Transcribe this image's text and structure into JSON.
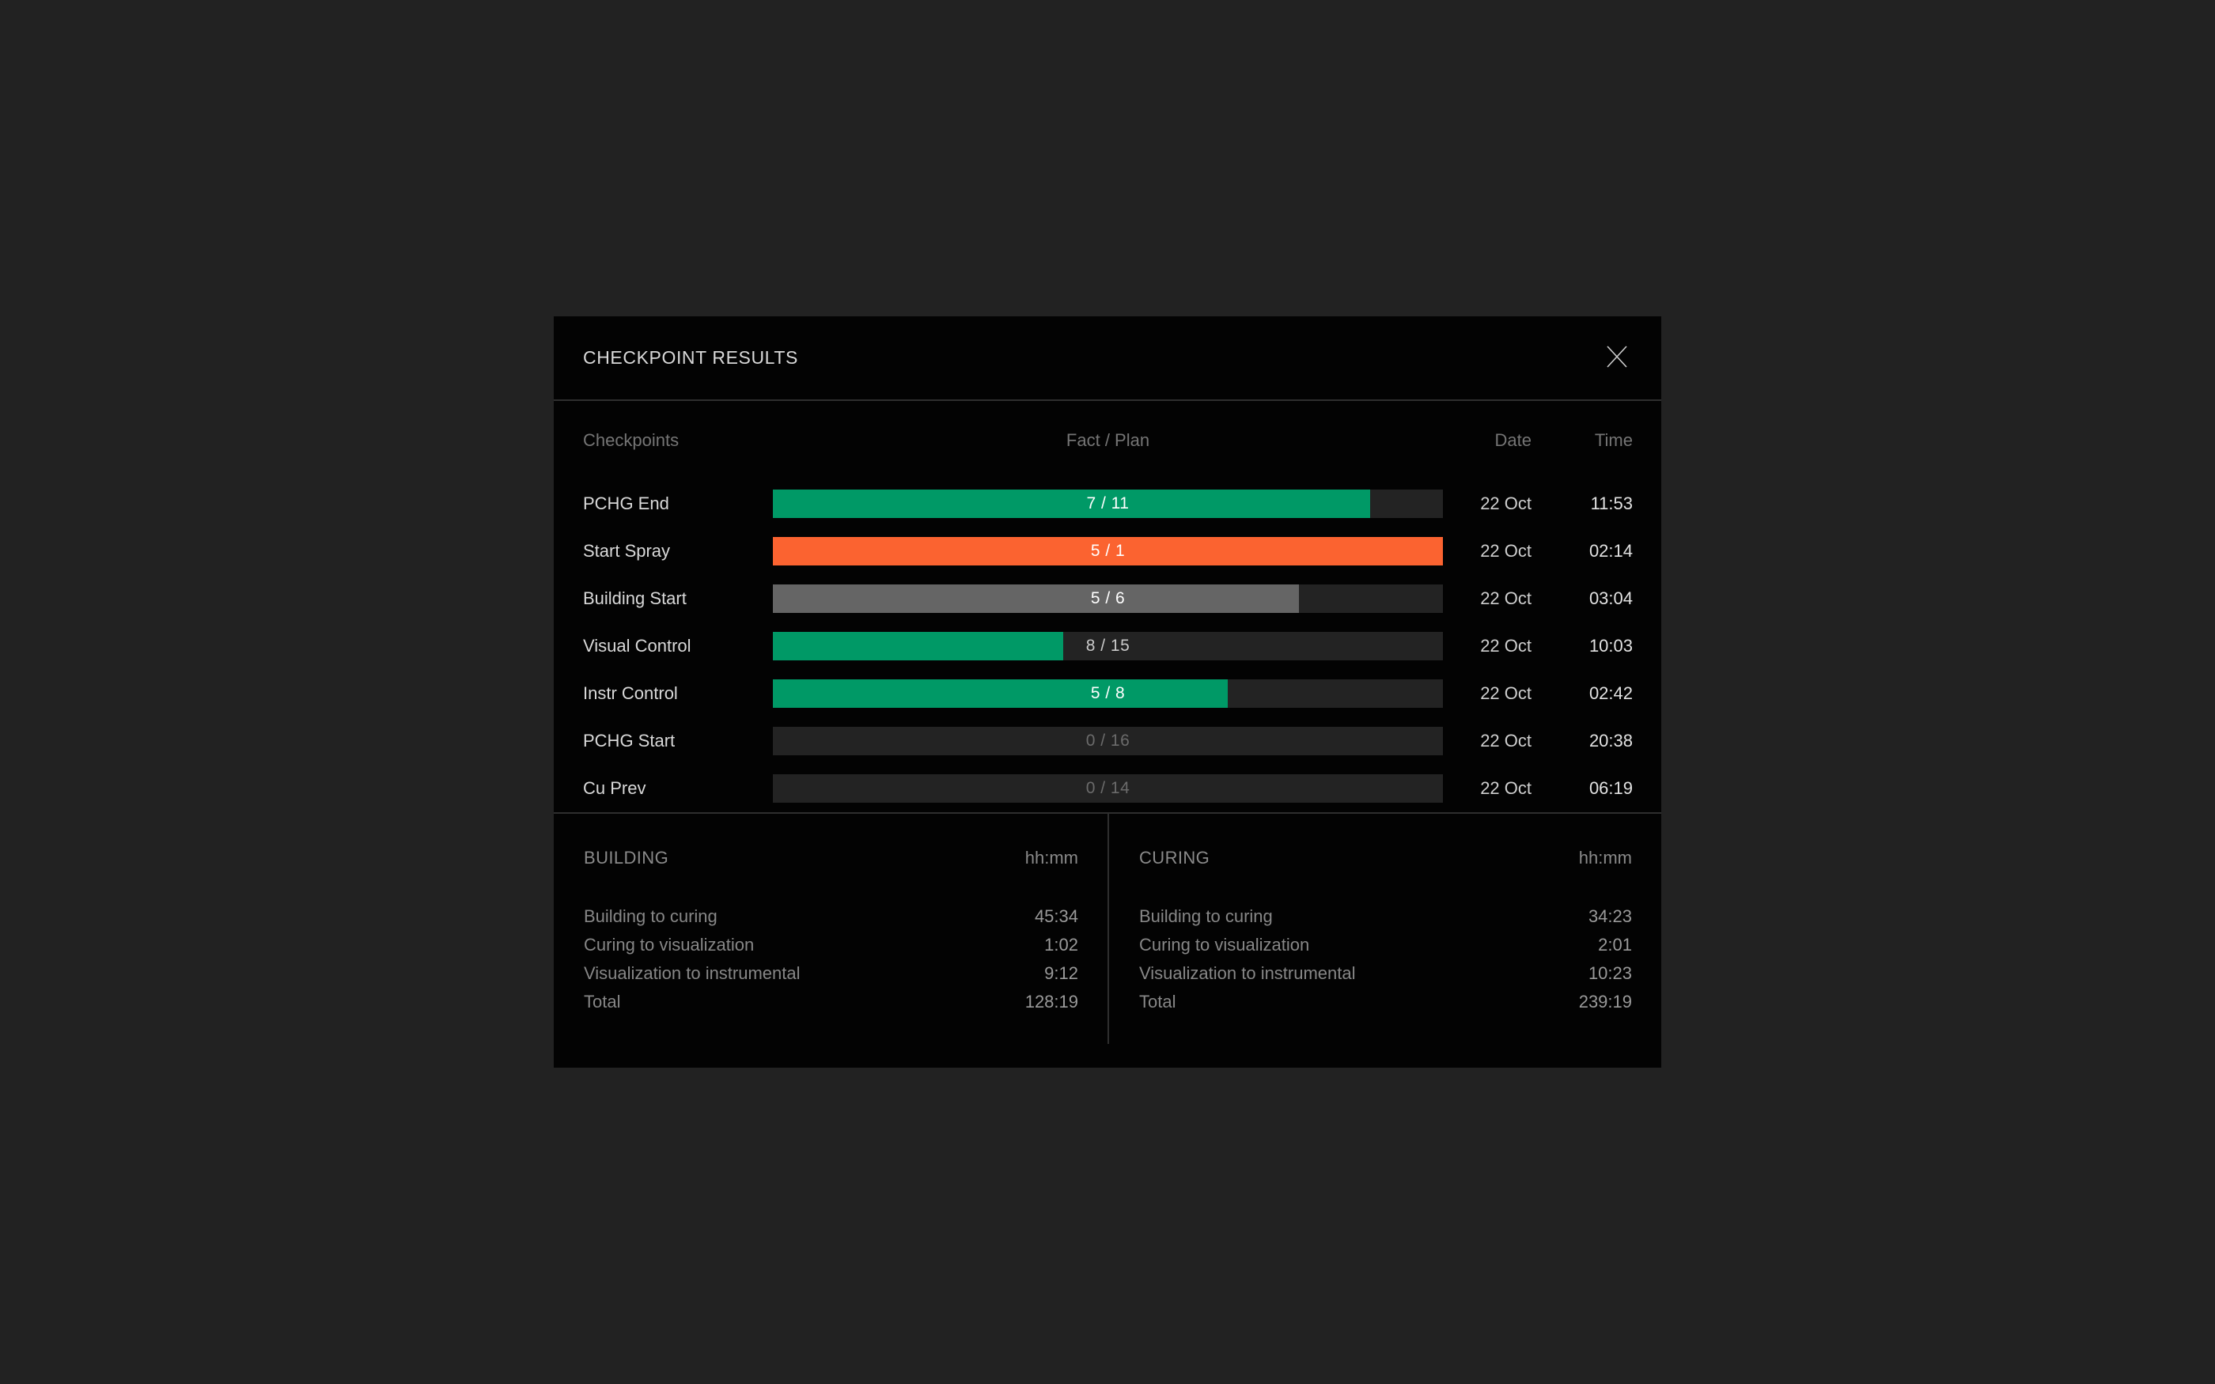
{
  "page": {
    "background": "#222222"
  },
  "modal": {
    "title": "CHECKPOINT RESULTS",
    "colors": {
      "green": "#009966",
      "orange": "#FB6330",
      "gray": "#656565",
      "track": "#232323"
    },
    "table": {
      "columns": {
        "checkpoints": "Checkpoints",
        "fact_plan": "Fact / Plan",
        "date": "Date",
        "time": "Time"
      },
      "rows": [
        {
          "label": "PCHG End",
          "fact": 7,
          "plan": 11,
          "display": "7 / 11",
          "fill_percent": 89.1,
          "fill_color": "#009966",
          "text_color": "#ffffff",
          "date": "22 Oct",
          "time": "11:53"
        },
        {
          "label": "Start Spray",
          "fact": 5,
          "plan": 1,
          "display": "5 / 1",
          "fill_percent": 100,
          "fill_color": "#FB6330",
          "text_color": "#ffffff",
          "date": "22 Oct",
          "time": "02:14"
        },
        {
          "label": "Building Start",
          "fact": 5,
          "plan": 6,
          "display": "5 / 6",
          "fill_percent": 78.5,
          "fill_color": "#656565",
          "text_color": "#ffffff",
          "date": "22 Oct",
          "time": "03:04"
        },
        {
          "label": "Visual Control",
          "fact": 8,
          "plan": 15,
          "display": "8 / 15",
          "fill_percent": 43.3,
          "fill_color": "#009966",
          "text_color": "#c9c9c9",
          "date": "22 Oct",
          "time": "10:03"
        },
        {
          "label": "Instr Control",
          "fact": 5,
          "plan": 8,
          "display": "5 / 8",
          "fill_percent": 67.9,
          "fill_color": "#009966",
          "text_color": "#ffffff",
          "date": "22 Oct",
          "time": "02:42"
        },
        {
          "label": "PCHG Start",
          "fact": 0,
          "plan": 16,
          "display": "0 / 16",
          "fill_percent": 0,
          "fill_color": null,
          "text_color": "#6b6b6b",
          "date": "22 Oct",
          "time": "20:38"
        },
        {
          "label": "Cu Prev",
          "fact": 0,
          "plan": 14,
          "display": "0 / 14",
          "fill_percent": 0,
          "fill_color": null,
          "text_color": "#6b6b6b",
          "date": "22 Oct",
          "time": "06:19"
        }
      ]
    },
    "panels": [
      {
        "title": "BUILDING",
        "unit": "hh:mm",
        "rows": [
          {
            "label": "Building to curing",
            "value": "45:34"
          },
          {
            "label": "Curing to visualization",
            "value": "1:02"
          },
          {
            "label": "Visualization to instrumental",
            "value": "9:12"
          },
          {
            "label": "Total",
            "value": "128:19"
          }
        ]
      },
      {
        "title": "CURING",
        "unit": "hh:mm",
        "rows": [
          {
            "label": "Building to curing",
            "value": "34:23"
          },
          {
            "label": "Curing to visualization",
            "value": "2:01"
          },
          {
            "label": "Visualization to instrumental",
            "value": "10:23"
          },
          {
            "label": "Total",
            "value": "239:19"
          }
        ]
      }
    ]
  }
}
